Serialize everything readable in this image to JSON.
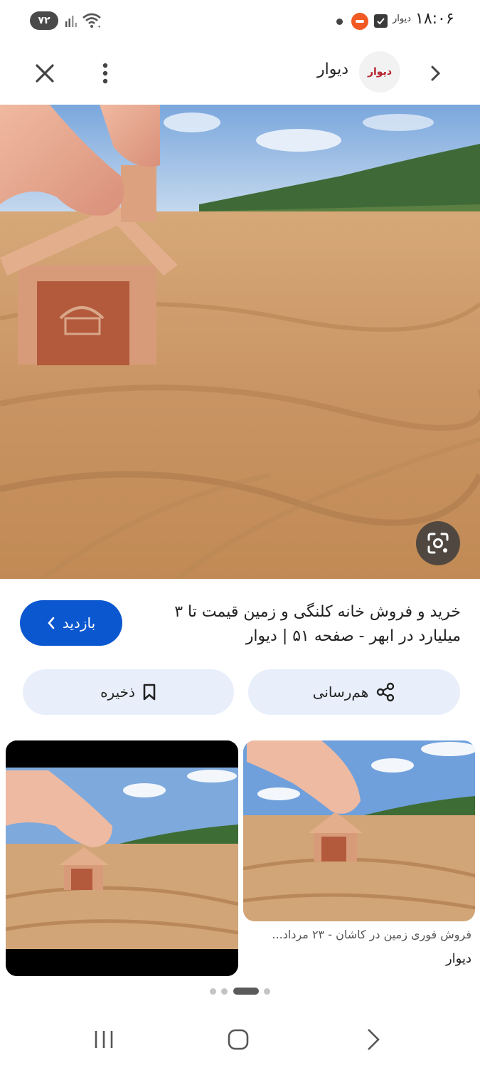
{
  "status_bar": {
    "battery": "۷۲",
    "app_name": "دیوار",
    "time": "۱۸:۰۶"
  },
  "header": {
    "site_name": "دیوار",
    "logo_text": "دیوار",
    "icons": [
      "close-icon",
      "more-vert-icon",
      "chevron-right-icon"
    ]
  },
  "result": {
    "title": "خرید و فروش خانه کلنگی و زمین قیمت تا ۳ میلیارد در ابهر - صفحه ۵۱ | دیوار",
    "visit_label": "بازدید"
  },
  "actions": {
    "share_label": "هم‌رسانی",
    "save_label": "ذخیره"
  },
  "related": {
    "caption": "فروش فوری زمین در کاشان - ۲۳ مرداد...",
    "source": "دیوار"
  },
  "pagination": {
    "active_index": 2,
    "count": 4
  },
  "colors": {
    "primary": "#0b57d0",
    "chip_bg": "#e8effa",
    "brand_red": "#b4232c"
  }
}
